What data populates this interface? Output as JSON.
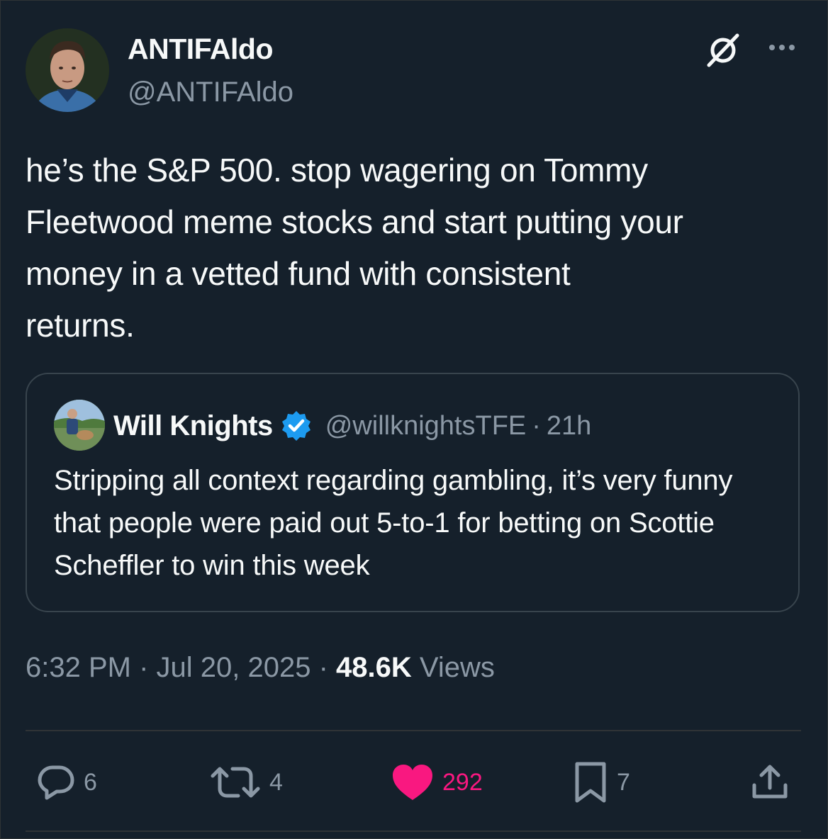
{
  "author": {
    "display_name": "ANTIFAldo",
    "handle": "@ANTIFAldo"
  },
  "tweet": {
    "text": "he’s the S&P 500. stop wagering on Tommy\nFleetwood meme stocks and start putting your\nmoney in a vetted fund with consistent\nreturns."
  },
  "quote": {
    "display_name": "Will Knights",
    "handle": "@willknightsTFE",
    "separator": "·",
    "time": "21h",
    "text": "Stripping all context regarding gambling, it’s very funny that people were paid out 5-to-1 for betting on Scottie Scheffler to win this week"
  },
  "meta": {
    "time": "6:32 PM",
    "sep1": " · ",
    "date": "Jul 20, 2025",
    "sep2": " · ",
    "views_count": "48.6K",
    "views_label": " Views"
  },
  "actions": {
    "replies": "6",
    "reposts": "4",
    "likes": "292",
    "bookmarks": "7"
  },
  "colors": {
    "background": "#15202b",
    "text": "#f7f9f9",
    "secondary": "#8b98a5",
    "like": "#f91880",
    "verified": "#1d9bf0"
  },
  "icons": [
    "grok-icon",
    "more-icon",
    "verified-icon",
    "reply-icon",
    "repost-icon",
    "like-icon",
    "bookmark-icon",
    "share-icon"
  ]
}
